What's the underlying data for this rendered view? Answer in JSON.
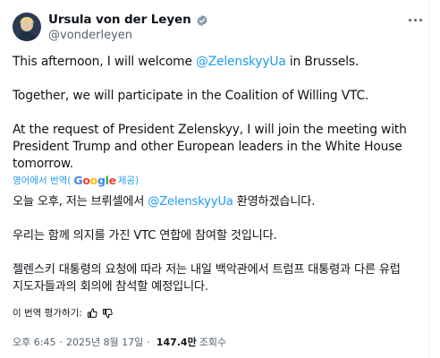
{
  "author": {
    "name": "Ursula von der Leyen",
    "handle": "@vonderleyen",
    "verified_color": "#829aab"
  },
  "tweet": {
    "line1_pre": "This afternoon, I will welcome ",
    "line1_mention": "@ZelenskyyUa",
    "line1_post": " in Brussels.",
    "line2": "Together, we will participate in the  Coalition of Willing VTC.",
    "line3": "At the request of President Zelenskyy, I will join the meeting with",
    "line4": "President Trump and other European leaders in the White House",
    "line5": "tomorrow."
  },
  "translation": {
    "label": "영어에서 번역(",
    "provider_g": "Google",
    "provider_suffix": " 제공)",
    "kr1_pre": "오늘 오후, 저는 브뤼셀에서 ",
    "kr1_mention": "@ZelenskyyUa",
    "kr1_post": " 환영하겠습니다.",
    "kr2": "우리는 함께 의지를 가진 VTC 연합에 참여할 것입니다.",
    "kr3": "젤렌스키 대통령의 요청에 따라 저는 내일 백악관에서 트럼프 대통령과 다른 유럽",
    "kr4": "지도자들과의 회의에 참석할 예정입니다.",
    "rate_label": "이 번역 평가하기:"
  },
  "meta": {
    "time": "오후 6:45",
    "date": "2025년 8월 17일",
    "views": "147.4만",
    "views_label": "조회수"
  },
  "colors": {
    "link": "#1d9bf0",
    "text": "#0f1419",
    "secondary": "#536471"
  }
}
